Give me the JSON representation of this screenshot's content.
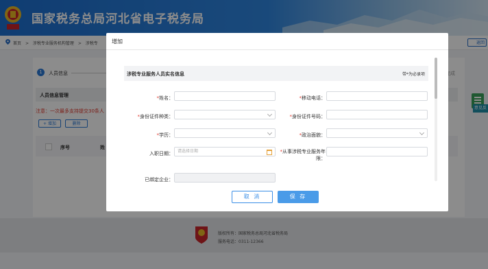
{
  "header": {
    "site_title": "国家税务总局河北省电子税务局",
    "colors": {
      "brand_blue": "#1d6fd0"
    }
  },
  "breadcrumb": {
    "items": [
      "首页",
      ">",
      "涉税专业服务机构管理",
      ">",
      "涉税专"
    ]
  },
  "back_button": {
    "label": "返回"
  },
  "steps": {
    "current_number": "1",
    "current_label": "人员信息",
    "right_label": "完成"
  },
  "section": {
    "title": "人员信息管理"
  },
  "notice": "注意：一次最多支持提交30条人",
  "toolbar": {
    "add_label": "+ 增加",
    "delete_label": "删除"
  },
  "table": {
    "columns": [
      "序号",
      "姓"
    ]
  },
  "side_widget": {
    "tag_label": "意见反"
  },
  "footer": {
    "line1": "版权所有：国家税务总局河北省税务局",
    "line2": "服务电话：0311-12366"
  },
  "modal": {
    "title": "增加",
    "form_title": "涉税专业服务人员实名信息",
    "required_note": "带*为必录项",
    "fields": {
      "name": {
        "label": "姓名：",
        "required": true
      },
      "mobile": {
        "label": "移动电话：",
        "required": true
      },
      "id_type": {
        "label": "身份证件种类：",
        "required": true
      },
      "id_number": {
        "label": "身份证件号码：",
        "required": true
      },
      "education": {
        "label": "学历：",
        "required": true
      },
      "political": {
        "label": "政治面貌：",
        "required": true
      },
      "entry_date": {
        "label": "入职日期：",
        "required": false,
        "placeholder": "请选择日期"
      },
      "years": {
        "label_line1": "从事涉税专业服务年",
        "label_line2": "限：",
        "required": true
      },
      "bound_company": {
        "label": "已绑定企业：",
        "required": false
      }
    },
    "required_mark": "*",
    "cancel_label": "取 消",
    "save_label": "保 存"
  }
}
